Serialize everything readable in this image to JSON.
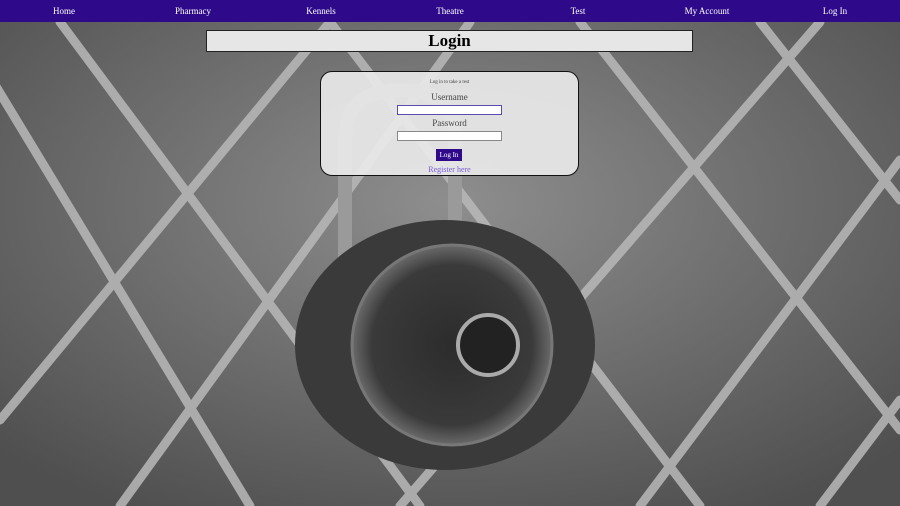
{
  "nav": {
    "items": [
      {
        "label": "Home"
      },
      {
        "label": "Pharmacy"
      },
      {
        "label": "Kennels"
      },
      {
        "label": "Theatre"
      },
      {
        "label": "Test"
      },
      {
        "label": "My Account"
      },
      {
        "label": "Log In"
      }
    ]
  },
  "page": {
    "title": "Login"
  },
  "login": {
    "hint": "Log in to take a test",
    "username_label": "Username",
    "username_value": "",
    "password_label": "Password",
    "password_value": "",
    "submit_label": "Log In",
    "register_link": "Register here"
  },
  "theme": {
    "nav_bg": "#2e0a8a",
    "link_color": "#7a5cd6",
    "card_bg": "#e8e8e8"
  },
  "background": {
    "icon": "padlock-on-chain-fence-photo"
  }
}
